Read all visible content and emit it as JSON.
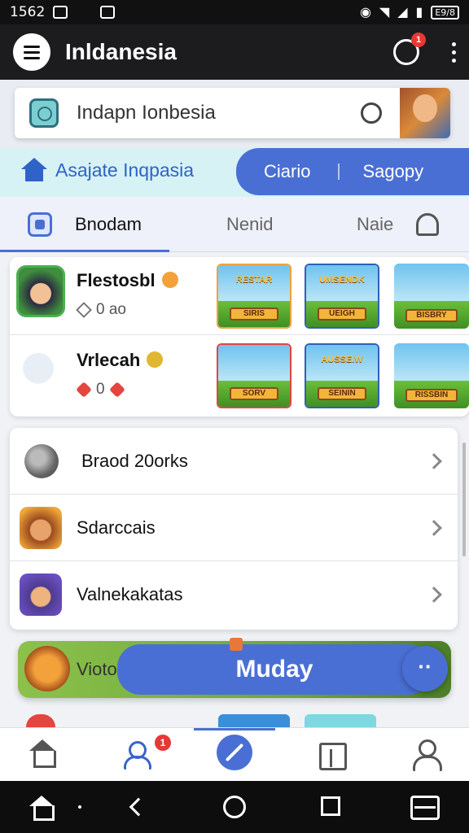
{
  "status_bar": {
    "time": "1562",
    "battery": "E9/8"
  },
  "app_bar": {
    "title": "Inldanesia",
    "notification_count": "1"
  },
  "search": {
    "text": "Indapn Ionbesia"
  },
  "category_bar": {
    "home_label": "Asajate Inqpasia",
    "pill_items": [
      "Ciario",
      "Sagopy"
    ]
  },
  "tabs": [
    {
      "label": "Bnodam",
      "active": true
    },
    {
      "label": "Nenid",
      "active": false
    },
    {
      "label": "Naie",
      "active": false
    }
  ],
  "games": [
    {
      "name": "Flestosbl",
      "meta": "0 ao",
      "thumbnails": [
        {
          "title": "RESTAR",
          "tag": "SIRIS"
        },
        {
          "title": "UMSENDK",
          "tag": "UEIGH"
        },
        {
          "title": "",
          "tag": "BISBRY"
        }
      ]
    },
    {
      "name": "Vrlecah",
      "meta": "0",
      "thumbnails": [
        {
          "title": "",
          "tag": "SORV"
        },
        {
          "title": "AUSSEIW",
          "tag": "SEININ"
        },
        {
          "title": "",
          "tag": "RISSBIN"
        }
      ]
    }
  ],
  "list_items": [
    {
      "label": "Braod 20orks"
    },
    {
      "label": "Sdarccais"
    },
    {
      "label": "Valnekakatas"
    }
  ],
  "promo": {
    "side_text": "Vioto",
    "button_label": "Muday",
    "fab_label": "··"
  },
  "bottom_nav": {
    "badge": "1",
    "items": [
      "home-icon",
      "friends-icon",
      "compass-icon",
      "box-icon",
      "profile-icon"
    ]
  },
  "colors": {
    "accent": "#4a6fd4",
    "app_bar": "#1c1c1e",
    "badge": "#e53935"
  }
}
